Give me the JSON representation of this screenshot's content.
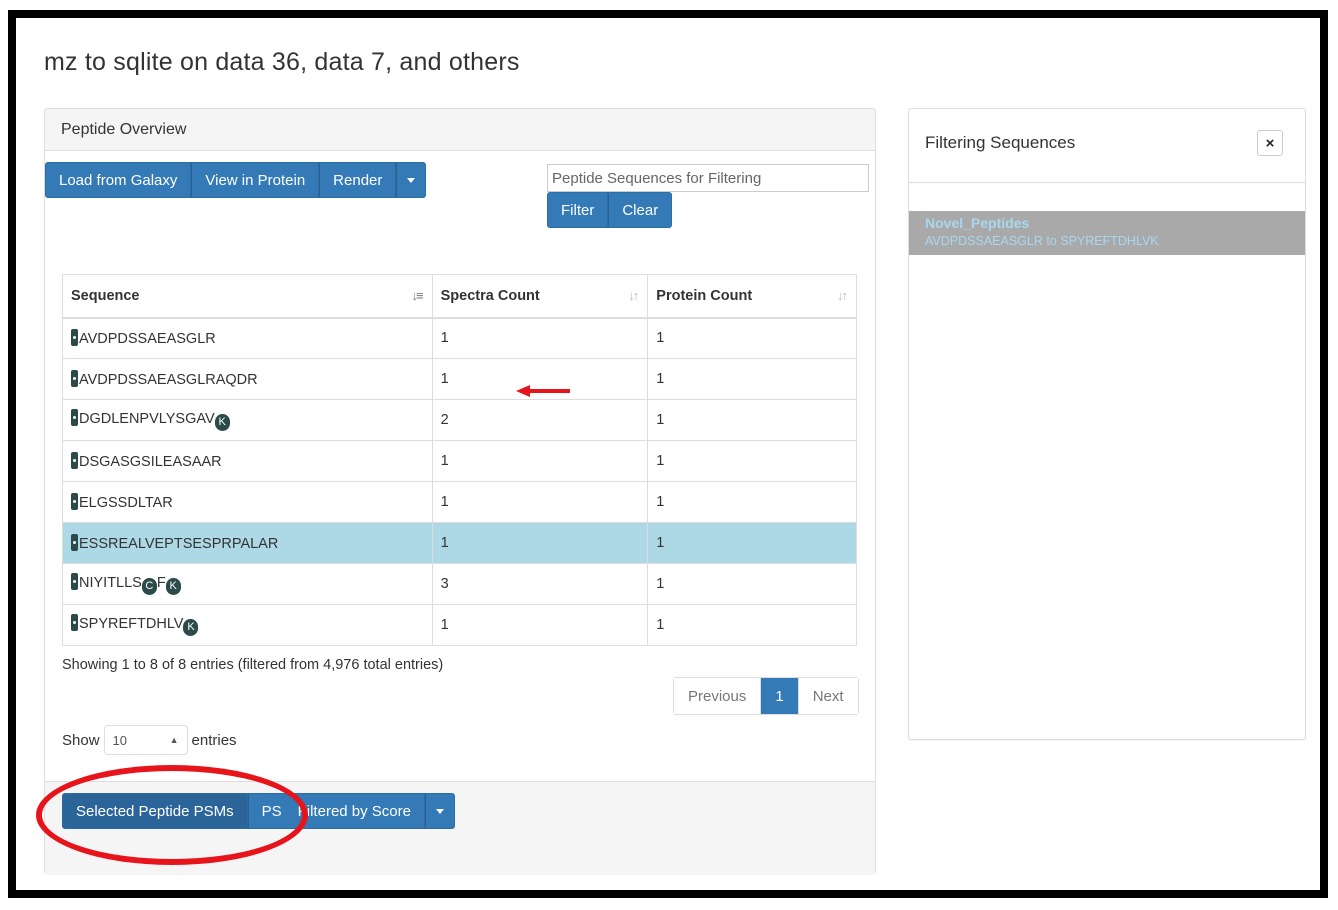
{
  "page": {
    "title": "mz to sqlite on data 36, data 7, and others"
  },
  "overview": {
    "heading": "Peptide Overview",
    "toolbar": {
      "load": "Load from Galaxy",
      "view": "View in Protein",
      "render": "Render"
    },
    "filter": {
      "placeholder": "Peptide Sequences for Filtering",
      "filter_label": "Filter",
      "clear_label": "Clear"
    },
    "table": {
      "columns": [
        "Sequence",
        "Spectra Count",
        "Protein Count"
      ],
      "rows": [
        {
          "sequence": "AVDPDSSAEASGLR",
          "spectra": "1",
          "protein": "1"
        },
        {
          "sequence": "AVDPDSSAEASGLRAQDR",
          "spectra": "1",
          "protein": "1"
        },
        {
          "sequence": "DGDLENPVLYSGAV",
          "suffix": "K",
          "spectra": "2",
          "protein": "1"
        },
        {
          "sequence": "DSGASGSILEASAAR",
          "spectra": "1",
          "protein": "1"
        },
        {
          "sequence": "ELGSSDLTAR",
          "spectra": "1",
          "protein": "1"
        },
        {
          "sequence": "ESSREALVEPTSESPRPALAR",
          "spectra": "1",
          "protein": "1",
          "selected": true
        },
        {
          "sequence": "NIYITLLS",
          "mid": "C",
          "mid2": "F",
          "suffix": "K",
          "spectra": "3",
          "protein": "1"
        },
        {
          "sequence": "SPYREFTDHLV",
          "suffix": "K",
          "spectra": "1",
          "protein": "1"
        }
      ]
    },
    "info": "Showing 1 to 8 of 8 entries (filtered from 4,976 total entries)",
    "pager": {
      "previous": "Previous",
      "page": "1",
      "next": "Next"
    },
    "length": {
      "show": "Show",
      "value": "10",
      "entries": "entries"
    },
    "footer": {
      "selected_psms": "Selected Peptide PSMs",
      "psms_filtered_prefix": "PS",
      "psms_filtered_suffix": "Filtered by Score"
    }
  },
  "filtering": {
    "heading": "Filtering Sequences",
    "close_icon": "×",
    "item": {
      "name": "Novel_Peptides",
      "range": "AVDPDSSAEASGLR to SPYREFTDHLVK"
    }
  },
  "colors": {
    "primary": "#337ab7",
    "selected_row": "#add8e6",
    "annotation": "#e8141c"
  }
}
